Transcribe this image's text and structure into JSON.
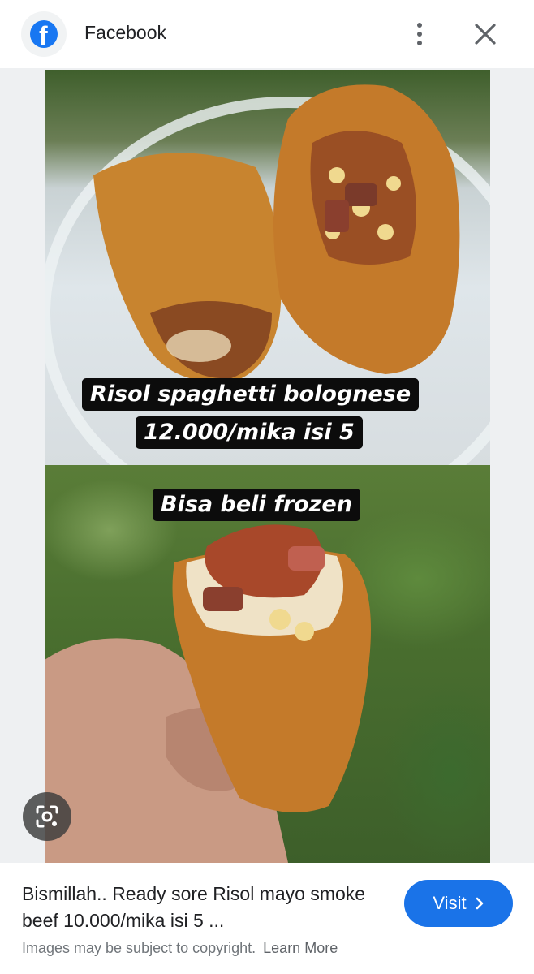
{
  "header": {
    "site_name": "Facebook",
    "logo_icon": "facebook-logo-icon",
    "more_icon": "more-vert-icon",
    "close_icon": "close-icon"
  },
  "image": {
    "caption_top_line1": "Risol spaghetti bolognese",
    "caption_top_line2": "12.000/mika isi 5",
    "caption_bottom": "Bisa beli frozen",
    "lens_icon": "google-lens-icon"
  },
  "footer": {
    "title": "Bismillah.. Ready sore Risol mayo smoke beef 10.000/mika isi 5 ...",
    "visit_label": "Visit",
    "copyright_text": "Images may be subject to copyright.",
    "learn_more_label": "Learn More"
  },
  "colors": {
    "facebook_blue": "#1877f2",
    "visit_button": "#1a73e8",
    "caption_bg": "#0c0c0c"
  }
}
